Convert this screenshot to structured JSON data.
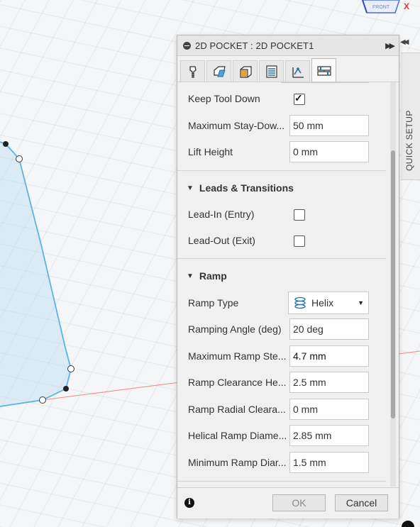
{
  "viewport": {
    "axis_label": "X",
    "cube_label": "FRONT"
  },
  "panel": {
    "title": "2D POCKET : 2D POCKET1",
    "tabs": [
      {
        "icon": "tool-icon",
        "active": false
      },
      {
        "icon": "geometry-icon",
        "active": false
      },
      {
        "icon": "heights-icon",
        "active": false
      },
      {
        "icon": "passes-icon",
        "active": false
      },
      {
        "icon": "linking-icon",
        "active": true
      }
    ],
    "rows": {
      "keep_tool_down": {
        "label": "Keep Tool Down",
        "checked": true
      },
      "max_stay_down": {
        "label": "Maximum Stay-Dow...",
        "value": "50 mm"
      },
      "lift_height": {
        "label": "Lift Height",
        "value": "0 mm"
      }
    },
    "leads": {
      "title": "Leads & Transitions",
      "lead_in": {
        "label": "Lead-In (Entry)",
        "checked": false
      },
      "lead_out": {
        "label": "Lead-Out (Exit)",
        "checked": false
      }
    },
    "ramp": {
      "title": "Ramp",
      "ramp_type": {
        "label": "Ramp Type",
        "value": "Helix"
      },
      "ramping_angle": {
        "label": "Ramping Angle (deg)",
        "value": "20 deg"
      },
      "max_ramp_step": {
        "label": "Maximum Ramp Ste...",
        "value": "4.7 mm"
      },
      "ramp_clearance_height": {
        "label": "Ramp Clearance He...",
        "value": "2.5 mm"
      },
      "ramp_radial_clearance": {
        "label": "Ramp Radial Cleara...",
        "value": "0 mm"
      },
      "helical_ramp_diameter": {
        "label": "Helical Ramp Diame...",
        "value": "2.85 mm"
      },
      "min_ramp_diameter": {
        "label": "Minimum Ramp Diar...",
        "value": "1.5 mm"
      }
    },
    "footer": {
      "ok_label": "OK",
      "cancel_label": "Cancel"
    }
  },
  "side_tab": {
    "label": "QUICK SETUP"
  }
}
